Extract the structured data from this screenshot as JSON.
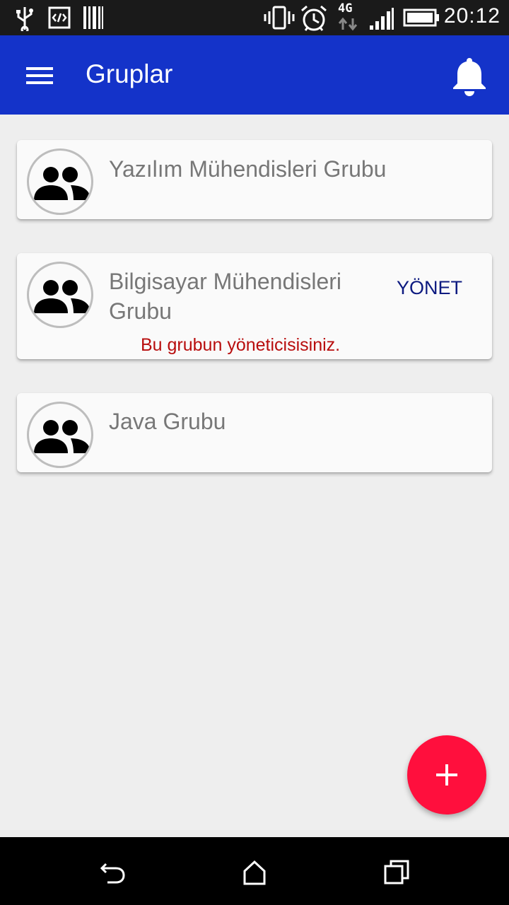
{
  "status_bar": {
    "time": "20:12",
    "network": "4G",
    "icons": [
      "usb-icon",
      "developer-code-icon",
      "barcode-icon",
      "vibrate-icon",
      "alarm-icon",
      "network-4g-icon",
      "signal-icon",
      "battery-icon"
    ]
  },
  "app_bar": {
    "title": "Gruplar",
    "background": "#1433c9",
    "menu_icon": "hamburger-menu-icon",
    "notification_icon": "bell-icon"
  },
  "groups": [
    {
      "name": "Yazılım Mühendisleri Grubu",
      "icon": "group-icon"
    },
    {
      "name": "Bilgisayar Mühendisleri Grubu",
      "icon": "group-icon",
      "action_label": "YÖNET",
      "admin_note": "Bu grubun yöneticisisiniz."
    },
    {
      "name": "Java Grubu",
      "icon": "group-icon"
    }
  ],
  "fab": {
    "icon": "plus-icon",
    "color": "#ff0f3d"
  },
  "colors": {
    "admin_note": "#b80d0d",
    "action": "#0d1a80",
    "group_name": "#777777"
  },
  "nav_bar": {
    "icons": [
      "back-icon",
      "home-icon",
      "recents-icon"
    ]
  }
}
